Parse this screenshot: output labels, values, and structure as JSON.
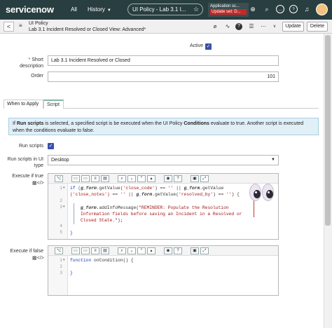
{
  "topbar": {
    "logo_text": "servicenow",
    "nav_all": "All",
    "nav_history": "History",
    "pill_title": "UI Policy - Lab 3.1 I...",
    "scope_line1": "Application sc...",
    "scope_line2": "Update set: D...",
    "icons": [
      "search-icon",
      "help-icon",
      "chat-icon",
      "bell-icon",
      "gear-icon",
      "avatar"
    ]
  },
  "header": {
    "record_type": "UI Policy",
    "record_name": "Lab 3.1 Incident Resolved or Closed",
    "view": "View: Advanced*",
    "update_label": "Update",
    "delete_label": "Delete"
  },
  "form": {
    "active_label": "Active",
    "active_checked": true,
    "short_description_label": "Short description",
    "short_description_value": "Lab 3.1 Incident Resolved or Closed",
    "order_label": "Order",
    "order_value": "101"
  },
  "tabs": [
    {
      "label": "When to Apply",
      "active": false
    },
    {
      "label": "Script",
      "active": true
    }
  ],
  "info": {
    "part1": "If ",
    "bold1": "Run scripts",
    "part2": " is selected, a specified script is be executed when the UI Policy ",
    "bold2": "Conditions",
    "part3": " evaluate to true. Another script is executed when the conditions evaluate to false."
  },
  "script": {
    "run_scripts_label": "Run scripts",
    "run_scripts_checked": true,
    "run_in_label": "Run scripts in UI type",
    "run_in_value": "Desktop",
    "exec_true_label": "Execute if true",
    "exec_false_label": "Execute if false",
    "true_lines": [
      {
        "n": "1",
        "text": ""
      },
      {
        "n": "",
        "text": ""
      },
      {
        "n": "2",
        "text": ""
      },
      {
        "n": "3",
        "text": ""
      },
      {
        "n": "",
        "text": ""
      },
      {
        "n": "",
        "text": ""
      },
      {
        "n": "4",
        "text": ""
      },
      {
        "n": "5",
        "text": ""
      }
    ],
    "true_code": {
      "l1a": "if (",
      "l1b": "g_form",
      "l1c": ".getValue(",
      "l1d": "'close_code'",
      "l1e": ") == ",
      "l1f": "''",
      "l1g": " || ",
      "l1h": "g_form",
      "l1i": ".getValue",
      "l2a": "('close_notes')",
      "l2b": " == ",
      "l2c": "''",
      "l2d": " || ",
      "l2e": "g_form",
      "l2f": ".getValue(",
      "l2g": "'resolved_by'",
      "l2h": ") == ",
      "l2i": "''",
      "l2j": ") {",
      "l3a": "g_form",
      "l3b": ".addInfoMessage(",
      "l3c": "\"REMINDER: Populate the Resolution",
      "l4": "Information fields before saving an Incident in a Resolved or",
      "l5": "Closed State.\"",
      "l5b": ");",
      "l7": "}"
    },
    "false_lines": [
      "1",
      "2",
      "3"
    ],
    "false_code": {
      "l1a": "function",
      "l1b": " onCondition() {",
      "l3": "}"
    },
    "toolbar_icons": [
      "comment-icon",
      "uncomment-icon",
      "format-icon",
      "replace-icon",
      "search-icon",
      "up-icon",
      "down-icon",
      "scope-icon",
      "help-icon",
      "save-icon",
      "fullscreen-icon"
    ]
  },
  "colors": {
    "topbar": "#293e40",
    "accent": "#81b5a1",
    "checkbox": "#3a50a8",
    "info_bg": "#e1eff7",
    "keyword": "#1b3fb5",
    "string": "#a31515"
  }
}
